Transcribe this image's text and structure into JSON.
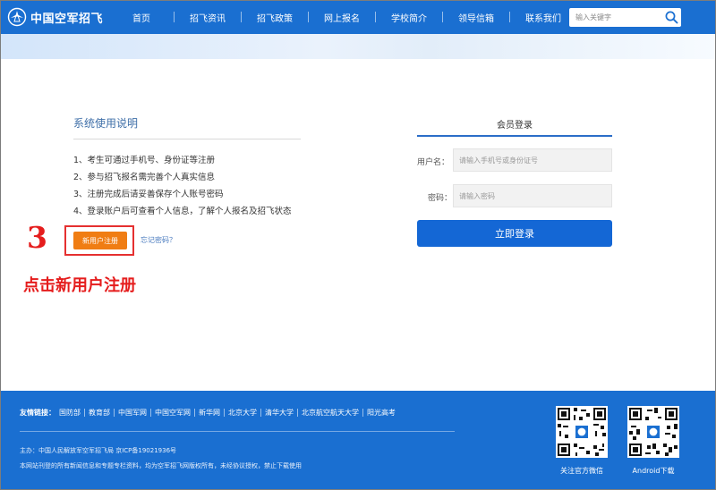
{
  "header": {
    "logo_text": "中国空军招飞",
    "nav": [
      "首页",
      "招飞资讯",
      "招飞政策",
      "网上报名",
      "学校简介",
      "领导信箱",
      "联系我们"
    ],
    "search_placeholder": "输入关键字"
  },
  "instructions": {
    "title": "系统使用说明",
    "items": [
      "1、考生可通过手机号、身份证等注册",
      "2、参与招飞报名需完善个人真实信息",
      "3、注册完成后请妥善保存个人账号密码",
      "4、登录账户后可查看个人信息，了解个人报名及招飞状态"
    ],
    "register_label": "新用户注册",
    "forgot_label": "忘记密码？"
  },
  "annotation": {
    "step_number": "3",
    "note": "点击新用户注册",
    "color": "#e51d1d"
  },
  "login": {
    "title": "会员登录",
    "username_label": "用户名：",
    "username_placeholder": "请输入手机号或身份证号",
    "password_label": "密码：",
    "password_placeholder": "请输入密码",
    "submit_label": "立即登录"
  },
  "footer": {
    "links_label": "友情链接：",
    "links": [
      "国防部",
      "教育部",
      "中国军网",
      "中国空军网",
      "新华网",
      "北京大学",
      "清华大学",
      "北京航空航天大学",
      "阳光高考"
    ],
    "host_line": "主办：中国人民解放军空军招飞局   京ICP备19021936号",
    "copyright_line": "本网站刊登的所有新闻信息和专题专栏资料，均为空军招飞网版权所有，未经协议授权，禁止下载使用",
    "qr_wechat_label": "关注官方微信",
    "qr_android_label": "Android下载"
  },
  "colors": {
    "brand_blue": "#1a6fd1",
    "button_blue": "#1467d5",
    "register_orange": "#f07d13"
  }
}
